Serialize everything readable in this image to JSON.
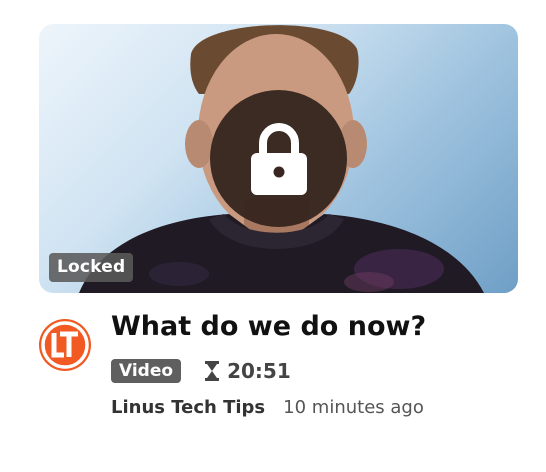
{
  "video": {
    "title": "What do we do now?",
    "locked_label": "Locked",
    "type_label": "Video",
    "duration": "20:51",
    "channel": "Linus Tech Tips",
    "published": "10 minutes ago"
  },
  "icons": {
    "lock": "lock-icon",
    "duration": "hourglass-icon",
    "channel_logo": "ltt-logo"
  },
  "colors": {
    "brand_orange": "#f15a22",
    "badge_gray": "#5f5f5f",
    "title_text": "#111111"
  }
}
